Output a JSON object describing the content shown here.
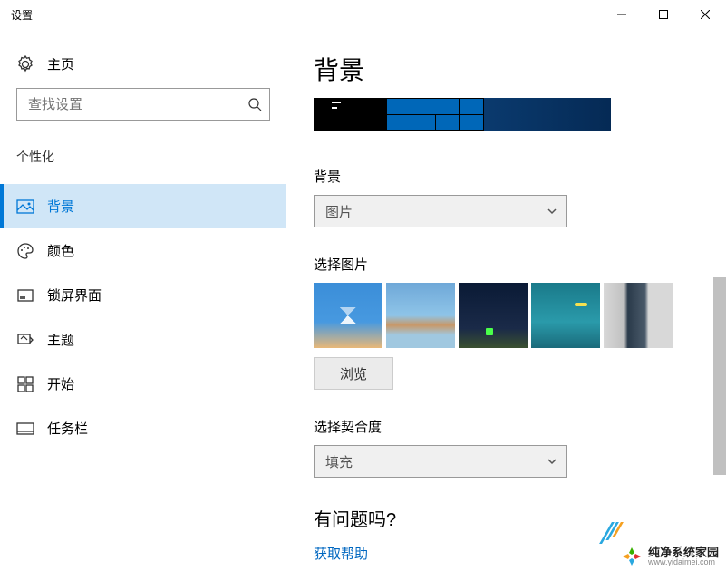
{
  "window": {
    "title": "设置"
  },
  "sidebar": {
    "home": "主页",
    "search_placeholder": "查找设置",
    "section": "个性化",
    "items": [
      {
        "label": "背景"
      },
      {
        "label": "颜色"
      },
      {
        "label": "锁屏界面"
      },
      {
        "label": "主题"
      },
      {
        "label": "开始"
      },
      {
        "label": "任务栏"
      }
    ]
  },
  "main": {
    "title": "背景",
    "bg_label": "背景",
    "bg_dropdown": "图片",
    "choose_label": "选择图片",
    "browse": "浏览",
    "fit_label": "选择契合度",
    "fit_dropdown": "填充",
    "help_heading": "有问题吗?",
    "help_link": "获取帮助"
  },
  "watermark": {
    "line1": "纯净系统家园",
    "line2": "www.yidaimei.com"
  }
}
